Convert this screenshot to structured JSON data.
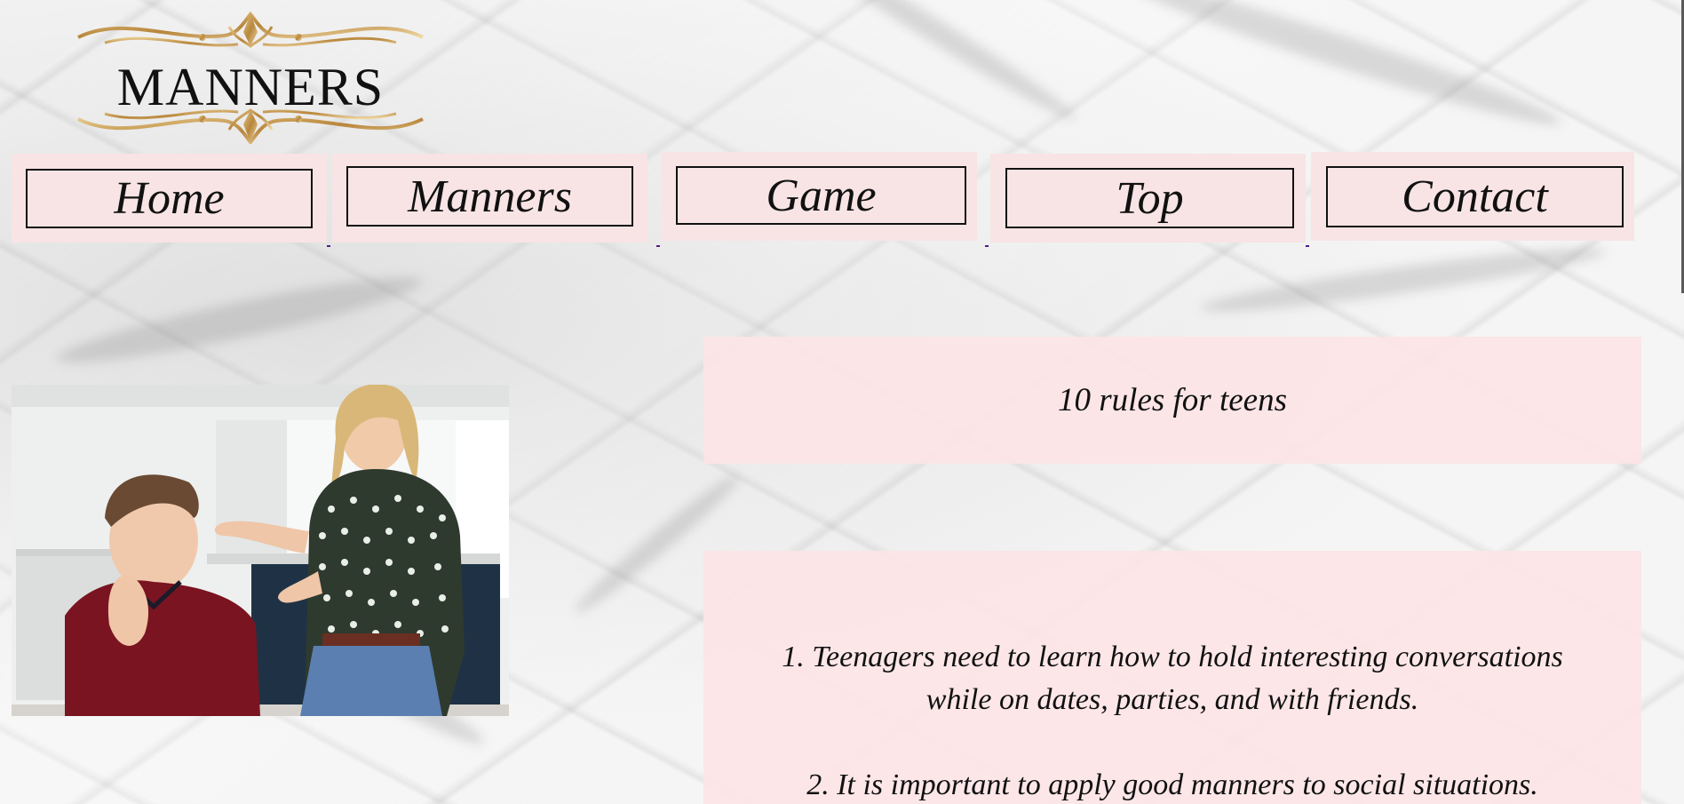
{
  "logo": {
    "text": "MANNERS",
    "accent": "#c9a15a"
  },
  "nav": {
    "items": [
      {
        "label": "Home"
      },
      {
        "label": "Manners"
      },
      {
        "label": "Game"
      },
      {
        "label": "Top"
      },
      {
        "label": "Contact"
      }
    ],
    "background": "#f8e4e5"
  },
  "photo": {
    "icon": "teen-and-parent-photo"
  },
  "content": {
    "title": "10 rules for teens",
    "rules": [
      "1. Teenagers need to learn how to hold interesting conversations while on dates, parties, and with friends.",
      "2. It is important to apply good manners to social situations."
    ],
    "panel_color": "#fce4e6"
  }
}
